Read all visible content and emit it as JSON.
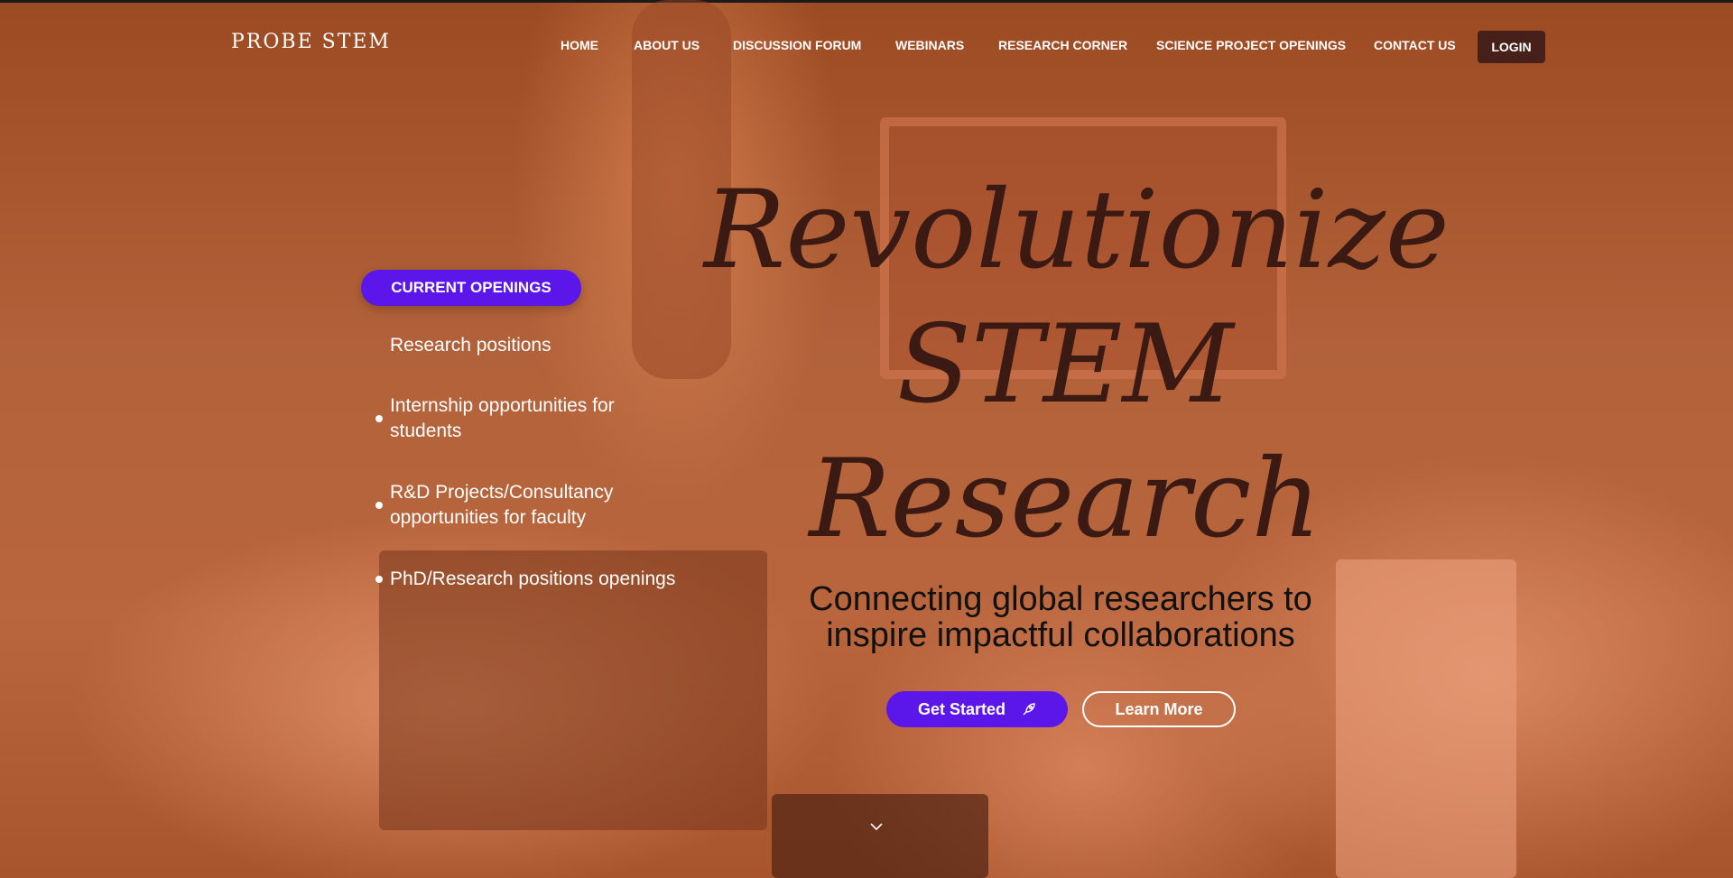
{
  "brand": {
    "logo": "PROBE STEM"
  },
  "nav": {
    "items": [
      "HOME",
      "ABOUT US",
      "DISCUSSION FORUM",
      "WEBINARS",
      "RESEARCH CORNER",
      "SCIENCE PROJECT OPENINGS",
      "CONTACT US"
    ],
    "login": "LOGIN"
  },
  "openings": {
    "title": "CURRENT OPENINGS",
    "items": [
      "Research positions",
      "Internship opportunities for students",
      "R&D Projects/Consultancy opportunities for faculty",
      "PhD/Research positions openings"
    ]
  },
  "hero": {
    "line1": "Revolutionize",
    "line2": "STEM",
    "line3": "Research",
    "subtitle": "Connecting global researchers to inspire impactful collaborations",
    "get_started": "Get Started",
    "learn_more": "Learn More"
  },
  "colors": {
    "accent": "#5b16ea",
    "login_bg": "#47201a",
    "overlay": "#a8542c"
  }
}
